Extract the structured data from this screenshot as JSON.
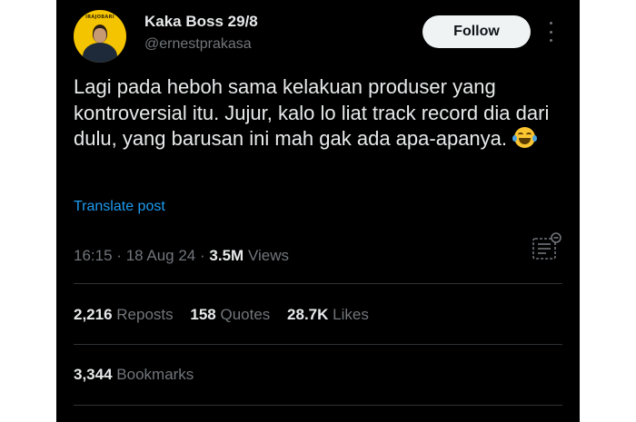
{
  "author": {
    "display_name": "Kaka Boss 29/8",
    "handle": "@ernestprakasa",
    "avatar_label": "IRAJOBARI"
  },
  "follow_label": "Follow",
  "post": {
    "text": "Lagi pada heboh sama kelakuan produser yang kontroversial itu. Jujur, kalo lo liat track record dia dari dulu, yang barusan ini mah gak ada apa-apanya.",
    "emoji": "face-with-tears-of-joy"
  },
  "translate_label": "Translate post",
  "meta": {
    "time": "16:15",
    "separator": "·",
    "date": "18 Aug 24",
    "views_count": "3.5M",
    "views_label": "Views"
  },
  "engagement": {
    "reposts_count": "2,216",
    "reposts_label": "Reposts",
    "quotes_count": "158",
    "quotes_label": "Quotes",
    "likes_count": "28.7K",
    "likes_label": "Likes",
    "bookmarks_count": "3,344",
    "bookmarks_label": "Bookmarks"
  },
  "colors": {
    "background": "#000000",
    "text_primary": "#e7e9ea",
    "text_secondary": "#71767b",
    "link": "#1d9bf0",
    "follow_button_bg": "#eff3f4",
    "avatar_bg": "#f5c400",
    "divider": "#2f3336"
  },
  "icons": [
    "more-options-icon",
    "community-notes-icon",
    "laughing-tears-emoji"
  ]
}
